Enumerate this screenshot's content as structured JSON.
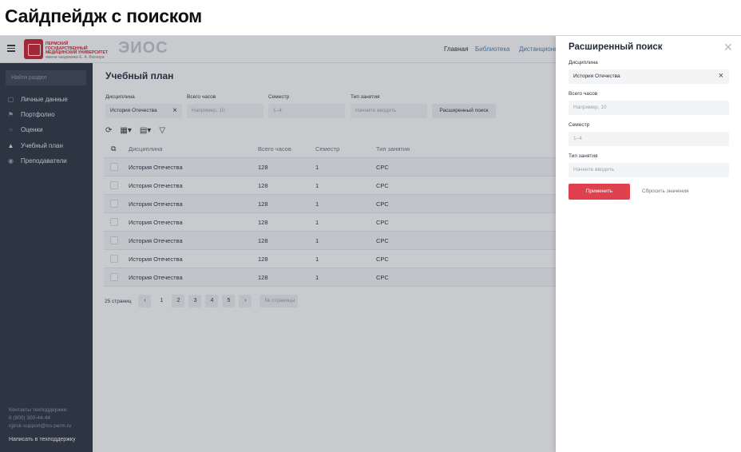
{
  "page_title": "Сайдпейдж с поиском",
  "header": {
    "logo_line1": "ПЕРМСКИЙ ГОСУДАРСТВЕННЫЙ",
    "logo_line2": "МЕДИЦИНСКИЙ УНИВЕРСИТЕТ",
    "logo_line3": "имени академика Е. А. Вагнера",
    "app_name": "ЭИОС",
    "nav": [
      "Главная",
      "Библиотека",
      "Дистанционн"
    ]
  },
  "sidebar": {
    "search_placeholder": "Найти раздел",
    "items": [
      {
        "label": "Личные данные",
        "icon": "calendar-icon"
      },
      {
        "label": "Портфолио",
        "icon": "portfolio-icon"
      },
      {
        "label": "Оценки",
        "icon": "chat-icon"
      },
      {
        "label": "Учебный план",
        "icon": "thumbs-up-icon"
      },
      {
        "label": "Преподаватели",
        "icon": "eye-icon"
      }
    ],
    "support_title": "Контакты техподдержки:",
    "support_phone": "8 (800) 300-44-44",
    "support_email": "rgirsk-support@ics.perm.ru",
    "support_link": "Написать в техподдержку"
  },
  "main": {
    "title": "Учебный план",
    "filters": {
      "discipline_label": "Дисциплина",
      "discipline_value": "История Отечества",
      "hours_label": "Всего часов",
      "hours_placeholder": "Например, 10",
      "semester_label": "Семестр",
      "semester_placeholder": "1–4",
      "type_label": "Тип занятия",
      "type_placeholder": "Начните вводить",
      "advanced_button": "Расширенный поиск"
    },
    "table": {
      "columns": [
        "Дисциплина",
        "Всего часов",
        "Семестр",
        "Тип занятия"
      ],
      "rows": [
        [
          "История Отечества",
          "128",
          "1",
          "СРС"
        ],
        [
          "История Отечества",
          "128",
          "1",
          "СРС"
        ],
        [
          "История Отечества",
          "128",
          "1",
          "СРС"
        ],
        [
          "История Отечества",
          "128",
          "1",
          "СРС"
        ],
        [
          "История Отечества",
          "128",
          "1",
          "СРС"
        ],
        [
          "История Отечества",
          "128",
          "1",
          "СРС"
        ],
        [
          "История Отечества",
          "128",
          "1",
          "СРС"
        ]
      ]
    },
    "pager": {
      "total_label": "25 страниц",
      "prev": "‹",
      "pages": [
        "1",
        "2",
        "3",
        "4",
        "5"
      ],
      "next": "›",
      "page_input_placeholder": "№ страницы"
    }
  },
  "drawer": {
    "title": "Расширенный поиск",
    "close": "✕",
    "discipline_label": "Дисциплина",
    "discipline_value": "История Отечества",
    "hours_label": "Всего часов",
    "hours_placeholder": "Например, 10",
    "semester_label": "Семестр",
    "semester_placeholder": "1–4",
    "type_label": "Тип занятия",
    "type_placeholder": "Начните вводить",
    "apply_button": "Применить",
    "reset_button": "Сбросить значения"
  },
  "colors": {
    "accent": "#e0414f",
    "sidebar_bg": "#28303e",
    "brand_red": "#c8202f"
  }
}
